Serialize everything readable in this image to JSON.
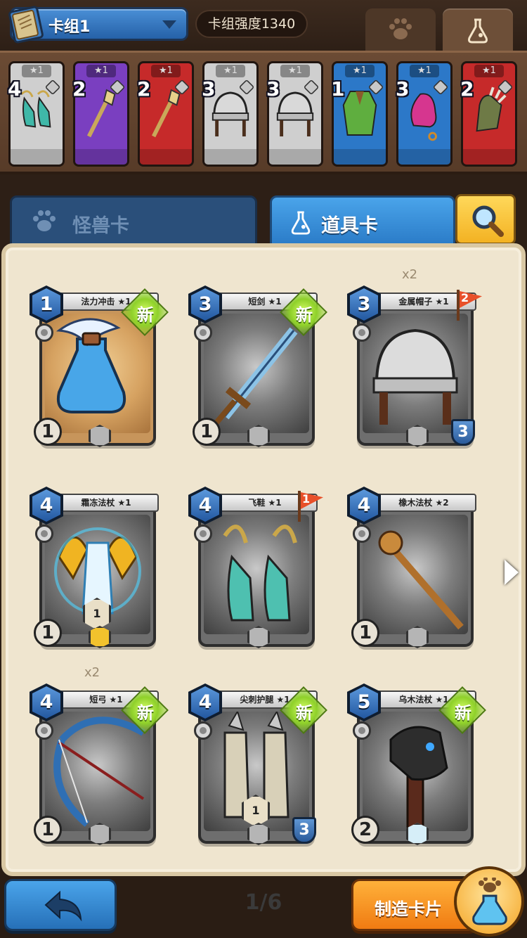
{
  "header": {
    "deck_label": "卡组1",
    "deck_strength": "卡组强度1340",
    "tabs": [
      {
        "icon": "paw-icon"
      },
      {
        "icon": "flask-icon"
      }
    ]
  },
  "deck_cards": [
    {
      "cost": "4",
      "stars": "★1",
      "color": "#cfcfcf",
      "art": "boots"
    },
    {
      "cost": "2",
      "stars": "★1",
      "color": "#7a3fc0",
      "art": "scepter"
    },
    {
      "cost": "2",
      "stars": "★1",
      "color": "#c62a2a",
      "art": "scepter"
    },
    {
      "cost": "3",
      "stars": "★1",
      "color": "#cfcfcf",
      "art": "helmet"
    },
    {
      "cost": "3",
      "stars": "★1",
      "color": "#cfcfcf",
      "art": "helmet"
    },
    {
      "cost": "1",
      "stars": "★1",
      "color": "#2c78c8",
      "art": "robe"
    },
    {
      "cost": "3",
      "stars": "★1",
      "color": "#2c78c8",
      "art": "hat"
    },
    {
      "cost": "2",
      "stars": "★1",
      "color": "#c62a2a",
      "art": "glove"
    }
  ],
  "categories": {
    "monster": "怪兽卡",
    "item": "道具卡"
  },
  "cards": [
    {
      "cost": "1",
      "name": "法力冲击 ★1",
      "level": "1",
      "new": "新",
      "art": "potion"
    },
    {
      "cost": "3",
      "name": "短剑 ★1",
      "level": "1",
      "new": "新",
      "art": "sword"
    },
    {
      "cost": "3",
      "name": "金属帽子 ★1",
      "count": "x2",
      "flag": "2",
      "shield": "3",
      "art": "helmet"
    },
    {
      "cost": "4",
      "name": "霜冻法杖 ★1",
      "level": "1",
      "badge": "1",
      "art": "icestaff"
    },
    {
      "cost": "4",
      "name": "飞鞋 ★1",
      "flag": "1",
      "art": "wingboots"
    },
    {
      "cost": "4",
      "name": "橡木法杖 ★2",
      "level": "1",
      "art": "oakstaff"
    },
    {
      "cost": "4",
      "name": "短弓 ★1",
      "count": "x2",
      "level": "1",
      "new": "新",
      "art": "bow"
    },
    {
      "cost": "4",
      "name": "尖刺护腿 ★1",
      "badge": "1",
      "shield": "3",
      "new": "新",
      "art": "greaves"
    },
    {
      "cost": "5",
      "name": "乌木法杖 ★1",
      "level": "2",
      "new": "新",
      "art": "ebonystaff"
    }
  ],
  "footer": {
    "page": "1/6",
    "craft_label": "制造卡片"
  }
}
